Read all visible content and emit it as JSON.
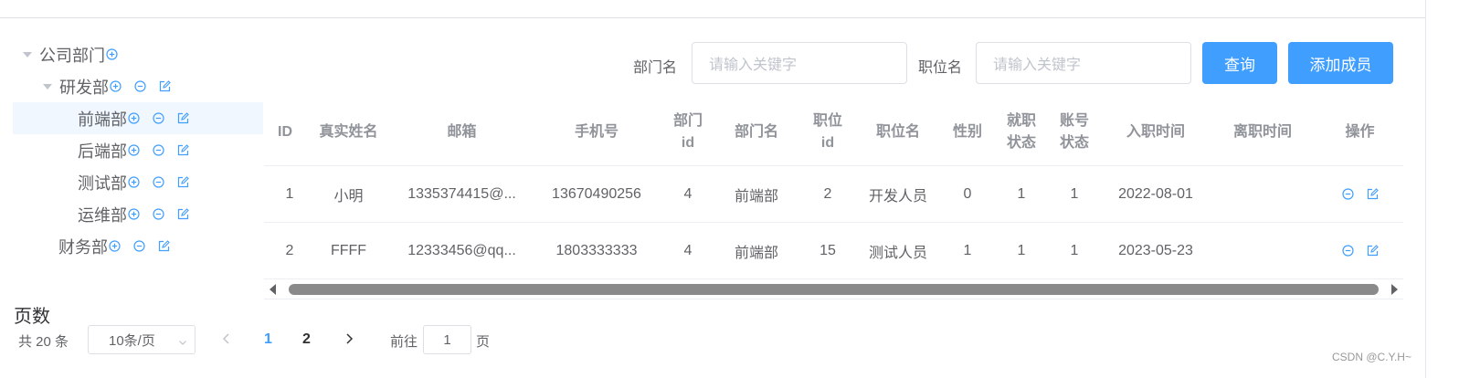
{
  "tree": {
    "root": {
      "label": "公司部门"
    },
    "dev": {
      "label": "研发部"
    },
    "frontend": {
      "label": "前端部"
    },
    "backend": {
      "label": "后端部"
    },
    "test": {
      "label": "测试部"
    },
    "ops": {
      "label": "运维部"
    },
    "finance": {
      "label": "财务部"
    }
  },
  "filters": {
    "dept_label": "部门名",
    "dept_placeholder": "请输入关键字",
    "position_label": "职位名",
    "position_placeholder": "请输入关键字",
    "query_button": "查询",
    "add_button": "添加成员"
  },
  "table": {
    "headers": [
      "ID",
      "真实姓名",
      "邮箱",
      "手机号",
      "部门id",
      "部门名",
      "职位id",
      "职位名",
      "性别",
      "就职状态",
      "账号状态",
      "入职时间",
      "离职时间",
      "操作"
    ],
    "rows": [
      [
        "1",
        "小明",
        "1335374415@...",
        "13670490256",
        "4",
        "前端部",
        "2",
        "开发人员",
        "0",
        "1",
        "1",
        "2022-08-01",
        ""
      ],
      [
        "2",
        "FFFF",
        "12333456@qq...",
        "1803333333",
        "4",
        "前端部",
        "15",
        "测试人员",
        "1",
        "1",
        "1",
        "2023-05-23",
        ""
      ]
    ]
  },
  "pagination": {
    "title": "页数",
    "total": "共 20 条",
    "page_size": "10条/页",
    "pages": [
      "1",
      "2"
    ],
    "current_page": "1",
    "goto_prefix": "前往",
    "goto_value": "1",
    "goto_suffix": "页"
  },
  "watermark": "CSDN @C.Y.H~",
  "colors": {
    "primary": "#409eff",
    "text": "#606266",
    "header": "#909399",
    "border": "#dcdfe6"
  },
  "icons": {
    "add": "circle-plus-icon",
    "remove": "circle-minus-icon",
    "edit": "edit-icon",
    "expand": "caret-down-icon"
  }
}
